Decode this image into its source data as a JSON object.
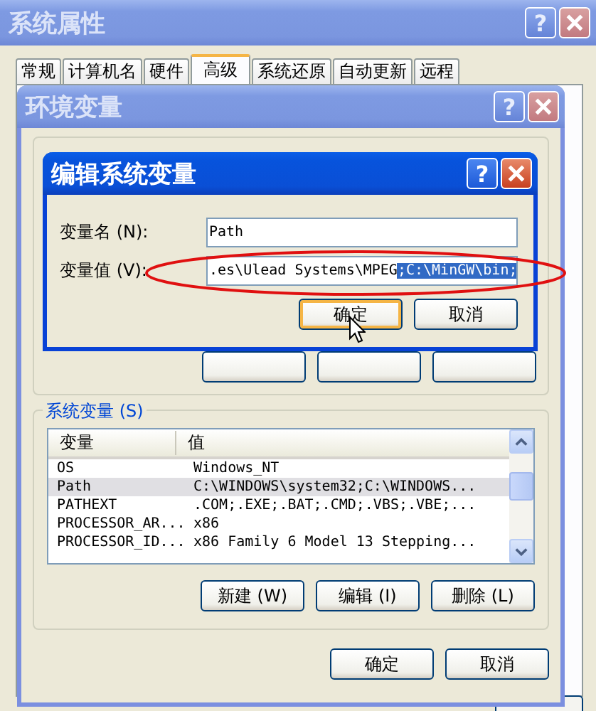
{
  "system_properties": {
    "title": "系统属性",
    "active": false,
    "help": "?",
    "tabs": [
      {
        "label": "常规",
        "selected": false
      },
      {
        "label": "计算机名",
        "selected": false
      },
      {
        "label": "硬件",
        "selected": false
      },
      {
        "label": "高级",
        "selected": true
      },
      {
        "label": "系统还原",
        "selected": false
      },
      {
        "label": "自动更新",
        "selected": false
      },
      {
        "label": "远程",
        "selected": false
      }
    ]
  },
  "environment_variables": {
    "title": "环境变量",
    "active": false,
    "help": "?",
    "system_variables": {
      "title": "系统变量 (S)",
      "columns": [
        "变量",
        "值"
      ],
      "rows": [
        {
          "name": "OS",
          "value": "Windows_NT",
          "selected": false
        },
        {
          "name": "Path",
          "value": "C:\\WINDOWS\\system32;C:\\WINDOWS...",
          "selected": true
        },
        {
          "name": "PATHEXT",
          "value": ".COM;.EXE;.BAT;.CMD;.VBS;.VBE;...",
          "selected": false
        },
        {
          "name": "PROCESSOR_AR...",
          "value": "x86",
          "selected": false
        },
        {
          "name": "PROCESSOR_ID...",
          "value": "x86 Family 6 Model 13 Stepping...",
          "selected": false
        }
      ]
    },
    "list_buttons": [
      "新建 (W)",
      "编辑 (I)",
      "删除 (L)"
    ],
    "buttons": [
      {
        "label": "确定",
        "default": false
      },
      {
        "label": "取消",
        "default": false
      }
    ]
  },
  "edit_dialog": {
    "title": "编辑系统变量",
    "active": true,
    "help": "?",
    "fields": [
      {
        "label": "变量名 (N):",
        "value": "Path"
      },
      {
        "label": "变量值 (V):",
        "value": ".es\\Ulead Systems\\MPEG",
        "selected_text": ";C:\\MinGW\\bin;"
      }
    ],
    "buttons": [
      {
        "label": "确定",
        "default": true
      },
      {
        "label": "取消",
        "default": false
      }
    ]
  }
}
